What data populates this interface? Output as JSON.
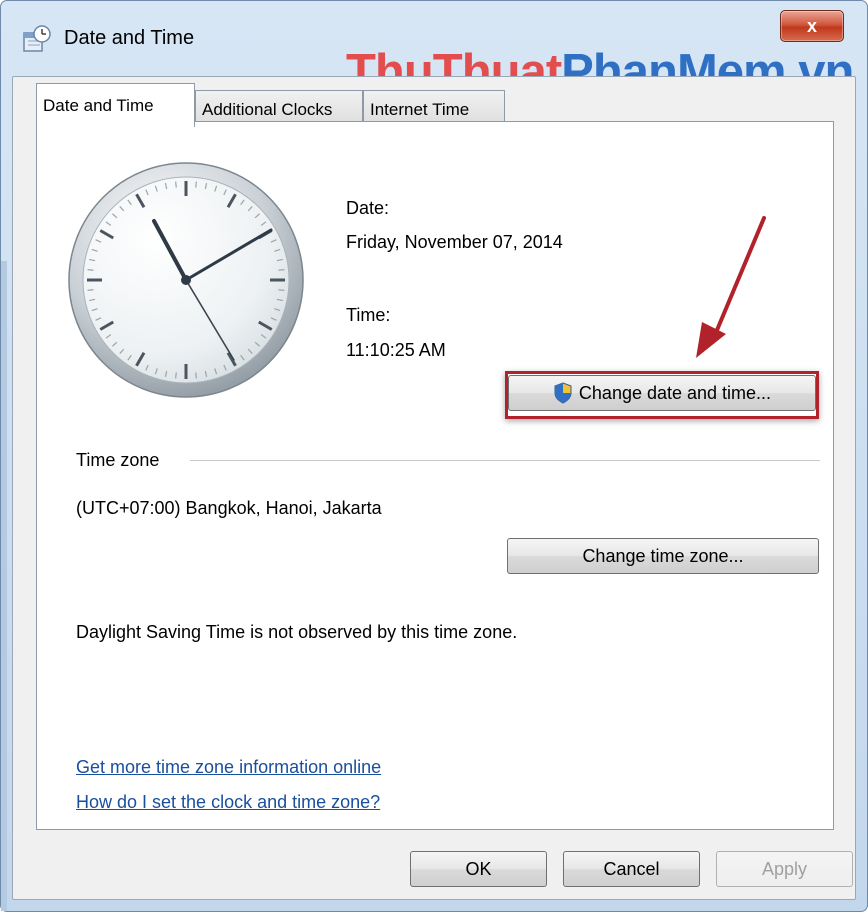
{
  "window": {
    "title": "Date and Time",
    "close_label": "x"
  },
  "watermark": {
    "part1": "ThuThuat",
    "part2": "PhanMem.vn"
  },
  "tabs": [
    {
      "label": "Date and Time"
    },
    {
      "label": "Additional Clocks"
    },
    {
      "label": "Internet Time"
    }
  ],
  "datetime": {
    "date_label": "Date:",
    "date_value": "Friday, November 07, 2014",
    "time_label": "Time:",
    "time_value": "11:10:25 AM",
    "change_button": "Change date and time..."
  },
  "timezone": {
    "group_label": "Time zone",
    "value": "(UTC+07:00) Bangkok, Hanoi, Jakarta",
    "change_button": "Change time zone...",
    "dst_note": "Daylight Saving Time is not observed by this time zone."
  },
  "links": {
    "more_info": "Get more time zone information online",
    "how_to": "How do I set the clock and time zone?"
  },
  "footer": {
    "ok": "OK",
    "cancel": "Cancel",
    "apply": "Apply"
  },
  "colors": {
    "highlight": "#b1222a",
    "arrow": "#b1222a",
    "link": "#1a4fa0"
  }
}
